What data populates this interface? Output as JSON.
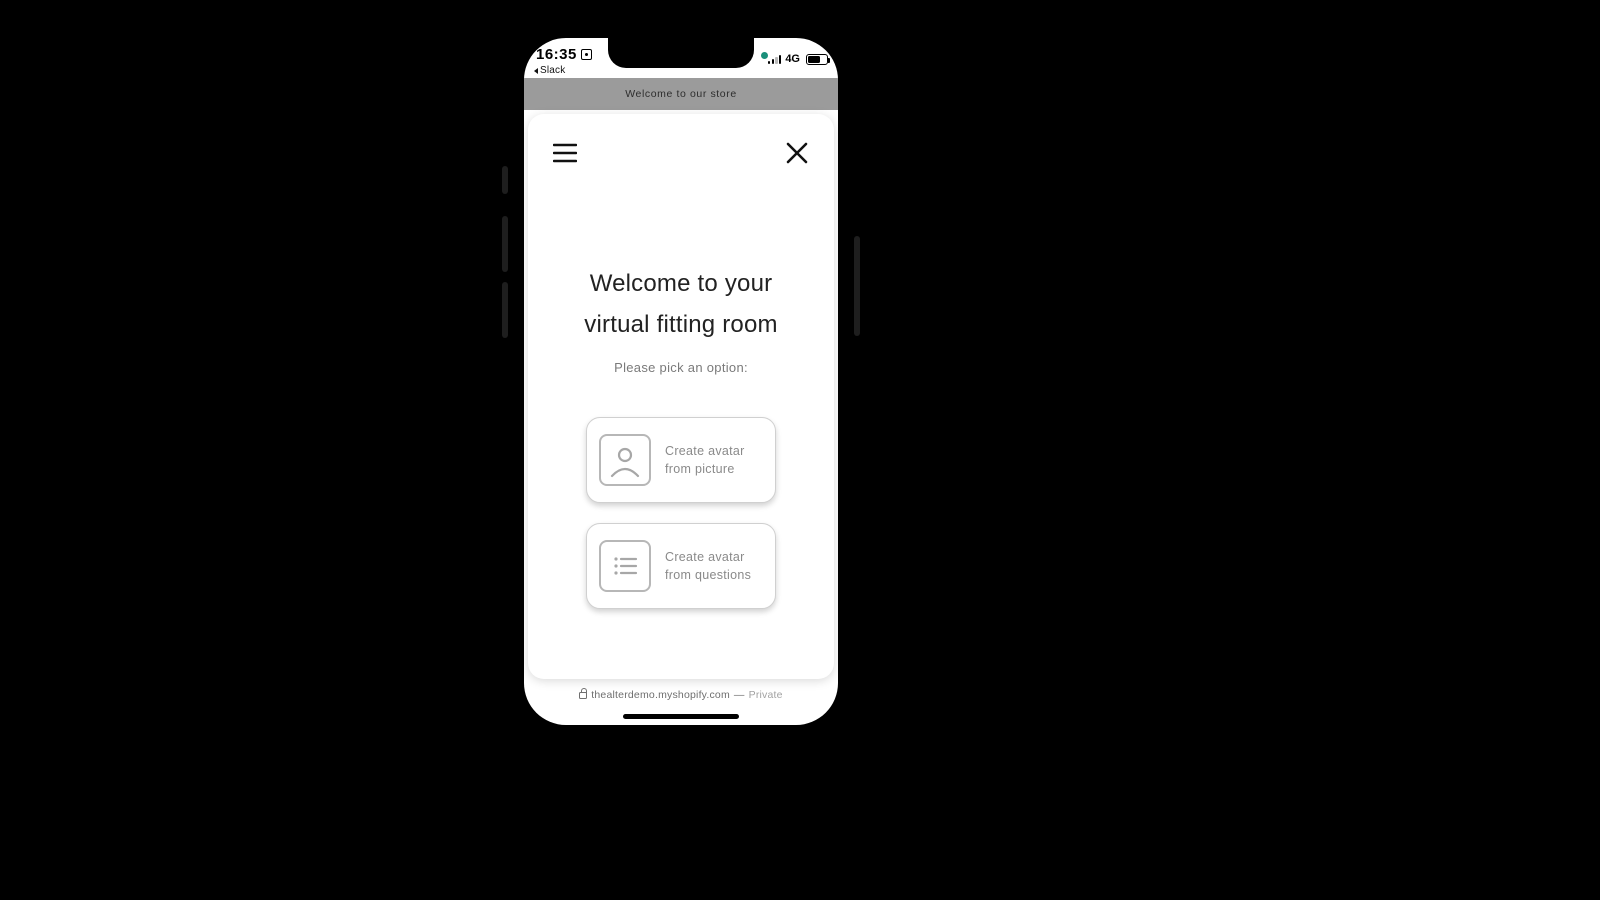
{
  "status": {
    "time": "16:35",
    "return_app": "Slack",
    "network_label": "4G"
  },
  "store_banner": "Welcome to our store",
  "modal": {
    "title": "Welcome to your virtual fitting room",
    "subtitle": "Please pick an option:",
    "options": {
      "picture": {
        "line1": "Create avatar",
        "line2": "from picture"
      },
      "questions": {
        "line1": "Create avatar",
        "line2": "from questions"
      }
    }
  },
  "browser": {
    "url": "thealterdemo.myshopify.com",
    "separator": "—",
    "mode": "Private"
  }
}
